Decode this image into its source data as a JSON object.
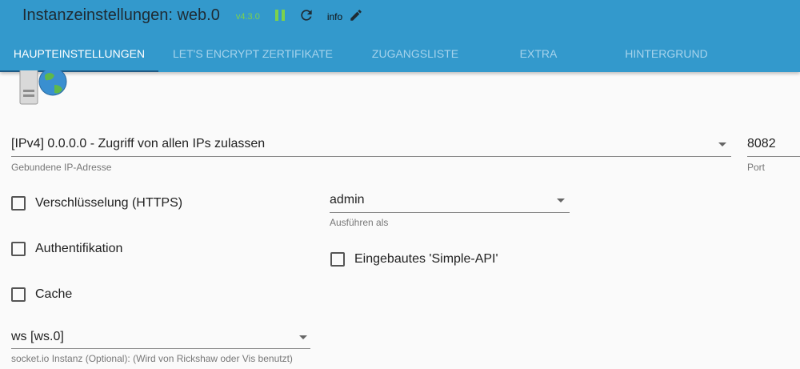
{
  "header": {
    "title": "Instanzeinstellungen: web.0",
    "version": "v4.3.0",
    "info_label": "info",
    "icons": [
      "pause-icon",
      "reload-icon",
      "edit-icon"
    ],
    "colors": {
      "header_bg": "#3399cc",
      "version": "#7dd24a",
      "pause": "#7dd24a"
    }
  },
  "tabs": [
    {
      "label": "HAUPTEINSTELLUNGEN",
      "active": true
    },
    {
      "label": "LET'S ENCRYPT ZERTIFIKATE",
      "active": false
    },
    {
      "label": "ZUGANGSLISTE",
      "active": false
    },
    {
      "label": "EXTRA",
      "active": false
    },
    {
      "label": "HINTERGRUND",
      "active": false
    }
  ],
  "form": {
    "bind": {
      "value": "[IPv4] 0.0.0.0 - Zugriff von allen IPs zulassen",
      "helper": "Gebundene IP-Adresse"
    },
    "port": {
      "value": "8082",
      "helper": "Port"
    },
    "https": {
      "label": "Verschlüsselung (HTTPS)",
      "checked": false
    },
    "auth": {
      "label": "Authentifikation",
      "checked": false
    },
    "cache": {
      "label": "Cache",
      "checked": false
    },
    "run_as": {
      "value": "admin",
      "helper": "Ausführen als"
    },
    "simple_api": {
      "label": "Eingebautes 'Simple-API'",
      "checked": false
    },
    "socket": {
      "value": "ws [ws.0]",
      "helper": "socket.io Instanz (Optional): (Wird von Rickshaw oder Vis benutzt)"
    }
  }
}
